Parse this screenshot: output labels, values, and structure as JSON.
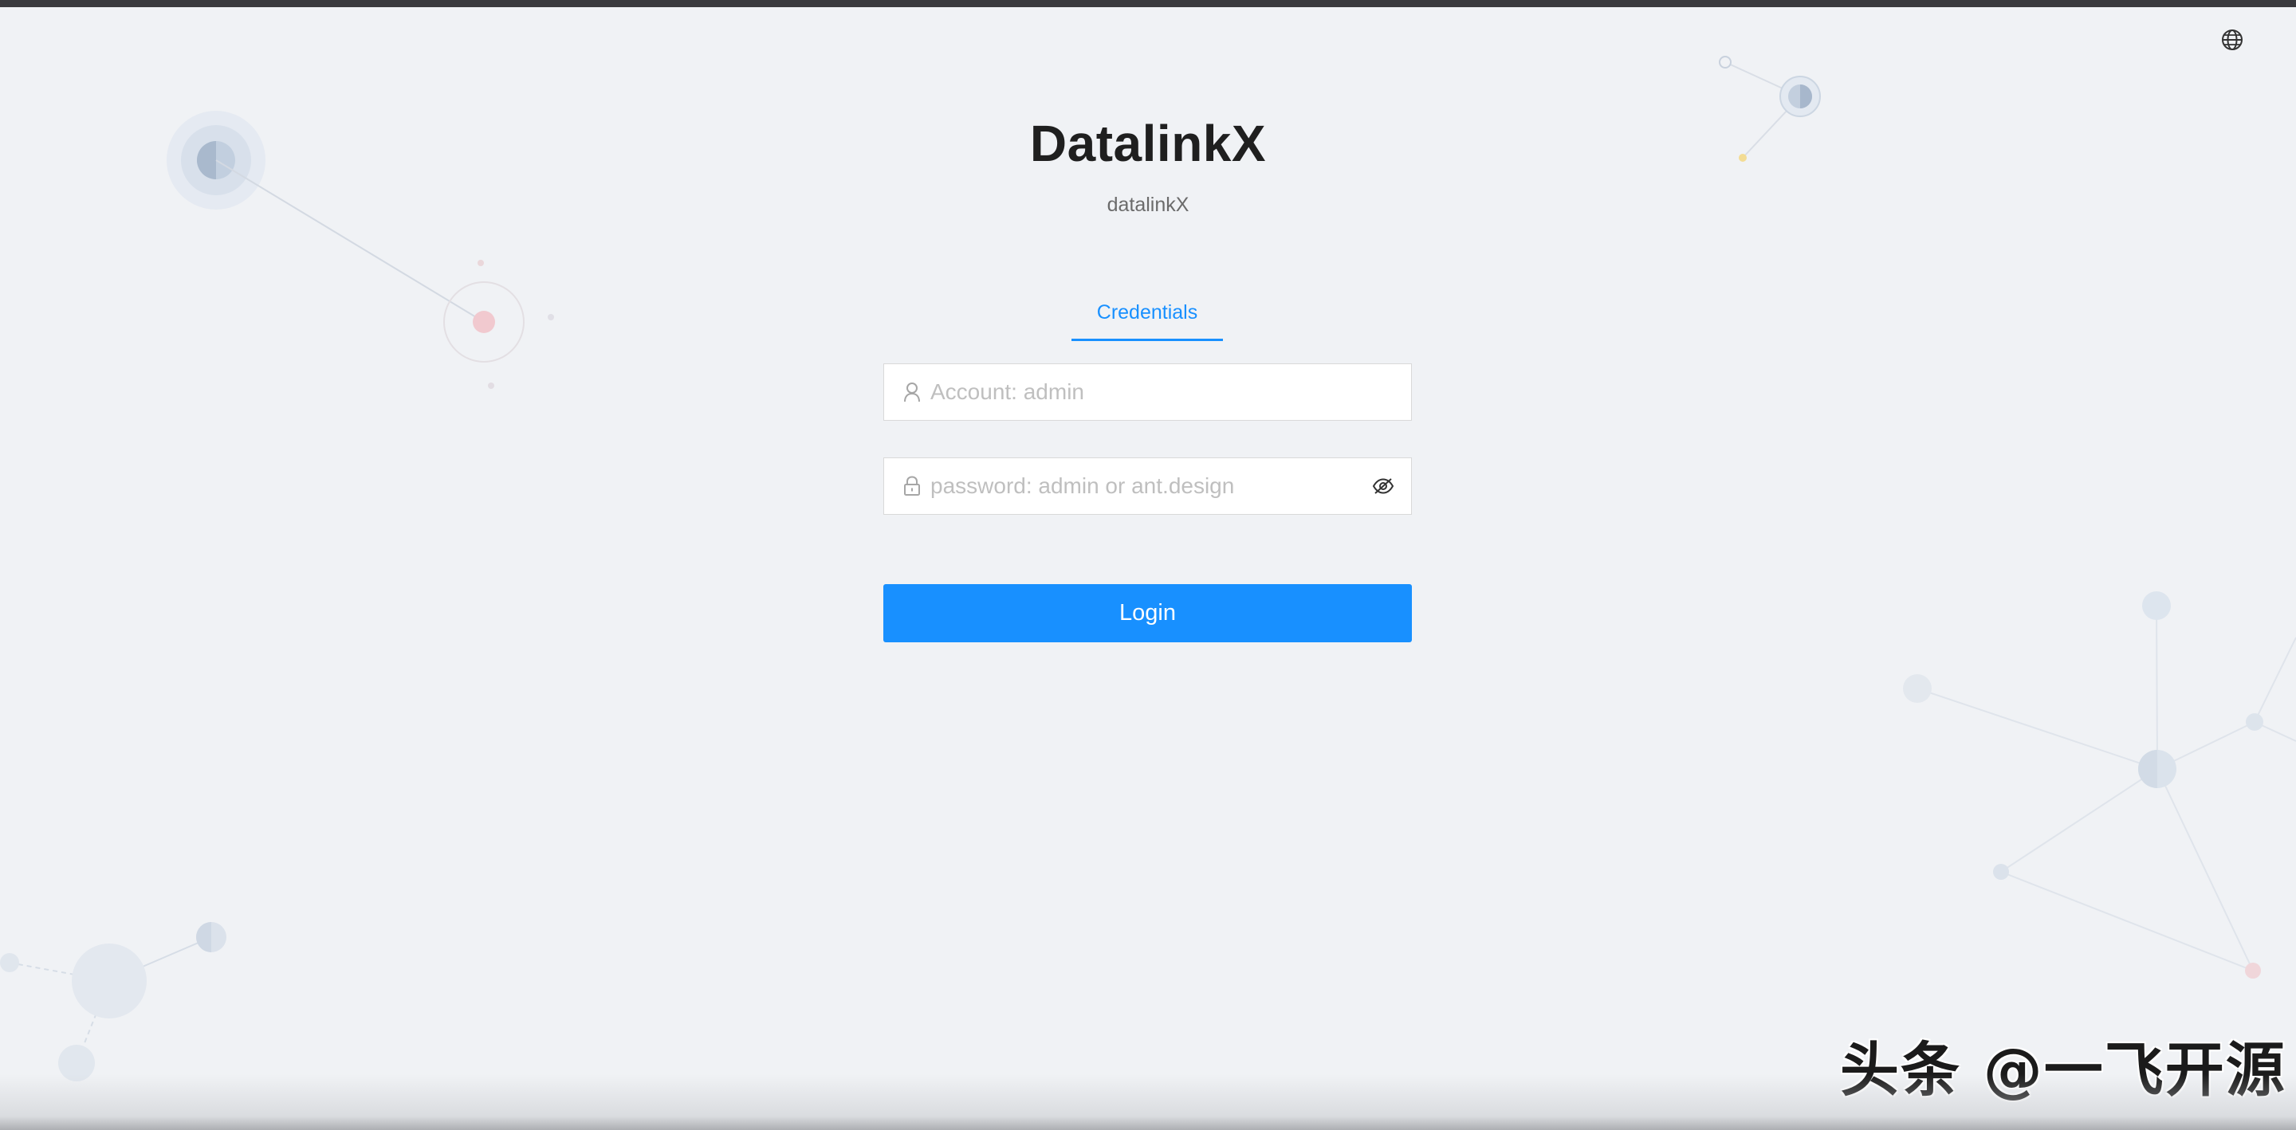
{
  "app": {
    "title": "DatalinkX",
    "subtitle": "datalinkX"
  },
  "language_switcher": {
    "icon": "globe-icon"
  },
  "tabs": [
    {
      "label": "Credentials",
      "active": true
    }
  ],
  "form": {
    "account": {
      "placeholder": "Account: admin",
      "value": "",
      "icon": "user-icon"
    },
    "password": {
      "placeholder": "password: admin or ant.design",
      "value": "",
      "icon": "lock-icon",
      "toggle_icon": "eye-invisible-icon"
    },
    "submit_label": "Login"
  },
  "colors": {
    "primary": "#1890ff",
    "background": "#f0f2f5",
    "title_text": "#1f1f1f"
  },
  "watermark": "头条 @一飞开源"
}
